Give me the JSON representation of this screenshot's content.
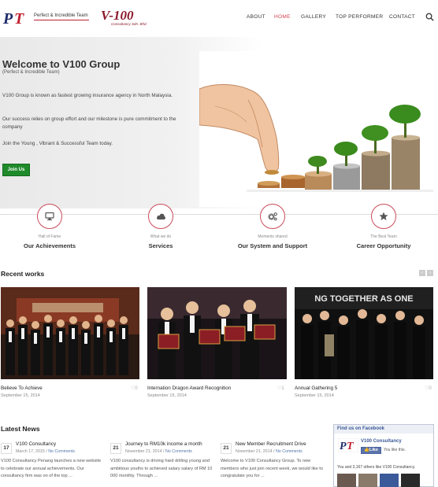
{
  "header": {
    "logo_pt_tagline": "Perfect & Incredible Team",
    "logo_v100": "V-100",
    "logo_v100_sub": "Consultancy Sdn. Bhd.",
    "nav": [
      "ABOUT",
      "HOME",
      "GALLERY",
      "TOP PERFORMER",
      "CONTACT"
    ],
    "active_nav": "HOME",
    "search_icon": "search-icon"
  },
  "hero": {
    "title": "Welcome to V100 Group",
    "subtitle": "(Perfect & Incredible Team)",
    "paragraph1": "V100 Group is known as fastest growing insurance agency in North Malaysia.",
    "paragraph2": "Our success relies on group effort and our milestone is pure commitment to the company",
    "paragraph3": "Join the Young , Vibrant & Successful Team today.",
    "join_button": "Join Us"
  },
  "features": [
    {
      "icon": "monitor-icon",
      "small": "Hall of Fame",
      "title": "Our Achievements"
    },
    {
      "icon": "cloud-icon",
      "small": "What we do",
      "title": "Services"
    },
    {
      "icon": "gears-icon",
      "small": "Moments shared",
      "title": "Our System and Support"
    },
    {
      "icon": "star-icon",
      "small": "The Best Team",
      "title": "Career Opportunity"
    }
  ],
  "recent_works": {
    "title": "Recent works",
    "items": [
      {
        "title": "Believe To Achieve",
        "date": "September 15, 2014",
        "likes": "0"
      },
      {
        "title": "Internation Dragon Award Recognition",
        "date": "September 15, 2014",
        "likes": "1"
      },
      {
        "title": "Annual Gathering 5",
        "date": "September 15, 2014",
        "likes": "0"
      }
    ]
  },
  "latest_news": {
    "title": "Latest News",
    "items": [
      {
        "day": "17",
        "title": "V100 Consultancy",
        "date": "March 17, 2015",
        "comments": "No Comments",
        "body": "V100 Consultancy Penang launches a new website to celebrate our annual achievements. Our consultancy firm was on of the top ..."
      },
      {
        "day": "21",
        "title": "Journey to RM10k income a month",
        "date": "November 21, 2014",
        "comments": "No Comments",
        "body": "V100 consultancy is driving hard drilling young and ambitious youths to achieved salary salary of RM 10 000 monthly. Through ..."
      },
      {
        "day": "21",
        "title": "New Member Recruitment Drive",
        "date": "November 21, 2014",
        "comments": "No Comments",
        "body": "Welcome to V100 Consultancy Group. To new members who just join recent week, we would like to congratulate you for ..."
      }
    ]
  },
  "facebook": {
    "header": "Find us on Facebook",
    "page_name": "V100 Consultancy",
    "like_label": "Like",
    "you_like": "You like this.",
    "friends_text": "You and 3,167 others like V100 Consultancy."
  },
  "colors": {
    "accent": "#d04050",
    "button_green": "#1f8a2a",
    "facebook_blue": "#3b5998"
  }
}
